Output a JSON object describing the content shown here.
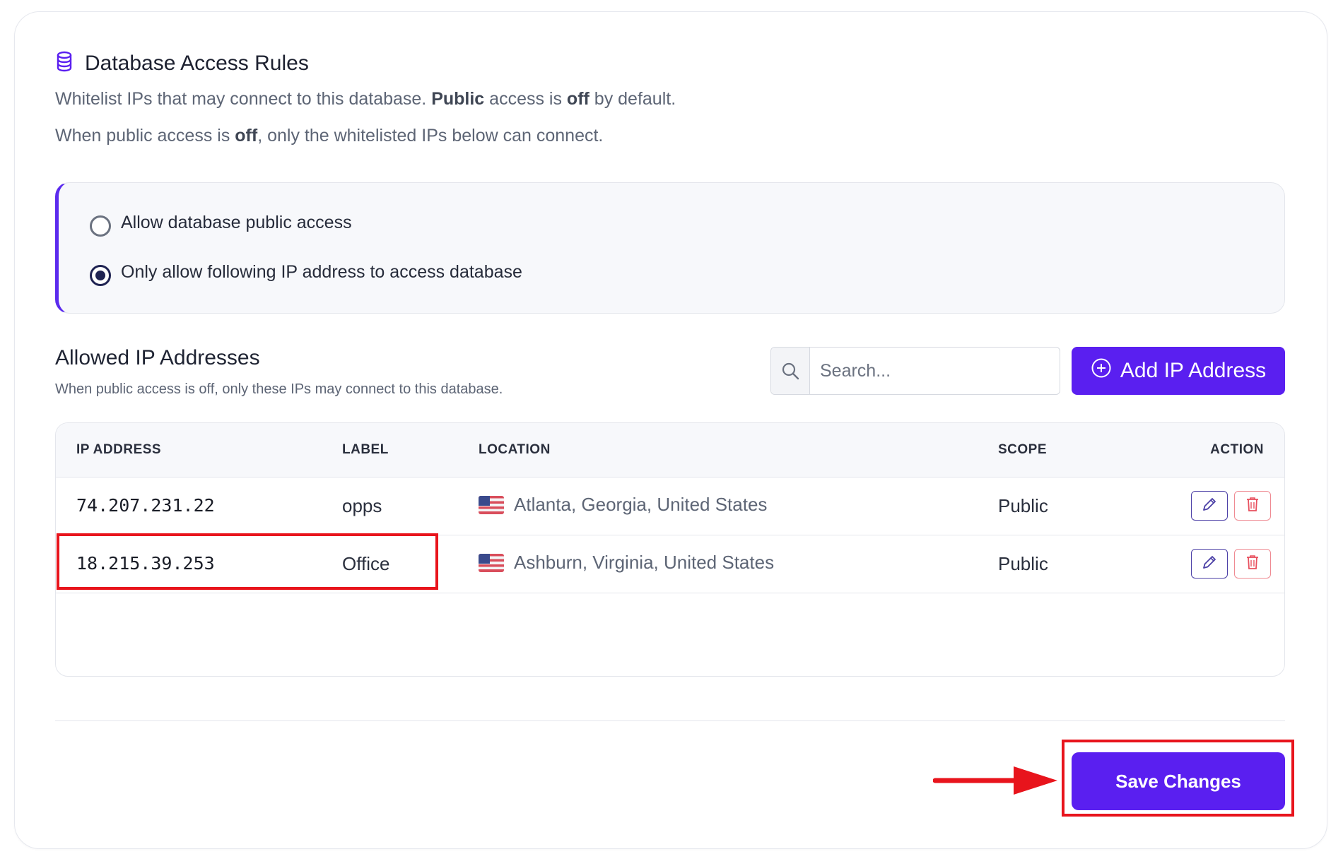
{
  "header": {
    "title": "Database Access Rules",
    "desc1_a": "Whitelist IPs that may connect to this database. ",
    "desc1_b": "Public",
    "desc1_c": " access is ",
    "desc1_d": "off",
    "desc1_e": " by default.",
    "desc2_a": "When public access is ",
    "desc2_b": "off",
    "desc2_c": ", only the whitelisted IPs below can connect."
  },
  "access_options": {
    "public_label": "Allow database public access",
    "whitelist_label": "Only allow following IP address to access database",
    "selected": "whitelist"
  },
  "allowed": {
    "title": "Allowed IP Addresses",
    "subtitle": "When public access is off, only these IPs may connect to this database.",
    "search_placeholder": "Search...",
    "add_button": "Add IP Address"
  },
  "table": {
    "columns": [
      "IP ADDRESS",
      "LABEL",
      "LOCATION",
      "SCOPE",
      "ACTION"
    ],
    "rows": [
      {
        "ip": "74.207.231.22",
        "label": "opps",
        "location": "Atlanta, Georgia, United States",
        "scope": "Public"
      },
      {
        "ip": "18.215.39.253",
        "label": "Office",
        "location": "Ashburn, Virginia, United States",
        "scope": "Public"
      }
    ]
  },
  "footer": {
    "save_button": "Save Changes"
  },
  "colors": {
    "accent": "#5a1ff0",
    "highlight": "#e8141c"
  }
}
